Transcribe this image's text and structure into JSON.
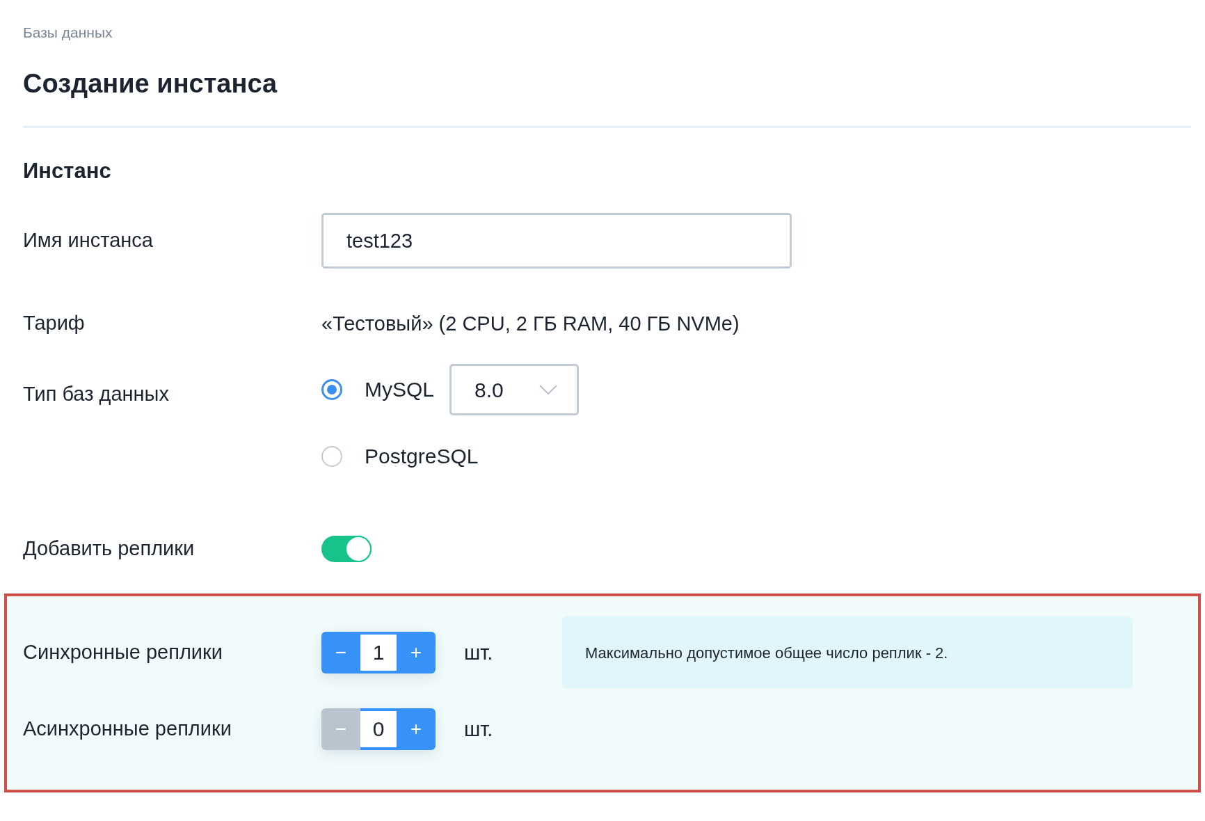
{
  "breadcrumb": "Базы данных",
  "title": "Создание инстанса",
  "section": "Инстанс",
  "name_field": {
    "label": "Имя инстанса",
    "value": "test123"
  },
  "tariff": {
    "label": "Тариф",
    "value": "«Тестовый» (2 CPU, 2 ГБ RAM, 40 ГБ NVMe)"
  },
  "db_type": {
    "label": "Тип баз данных",
    "options": [
      {
        "label": "MySQL",
        "selected": true,
        "version": "8.0"
      },
      {
        "label": "PostgreSQL",
        "selected": false
      }
    ]
  },
  "replicas_toggle": {
    "label": "Добавить реплики",
    "on": true
  },
  "replicas": {
    "rows": [
      {
        "label": "Синхронные реплики",
        "minus": "−",
        "value": "1",
        "plus": "+",
        "decrement_disabled": false,
        "unit": "шт."
      },
      {
        "label": "Асинхронные реплики",
        "minus": "−",
        "value": "0",
        "plus": "+",
        "decrement_disabled": true,
        "unit": "шт."
      }
    ],
    "note": "Максимально допустимое общее число реплик - 2."
  }
}
